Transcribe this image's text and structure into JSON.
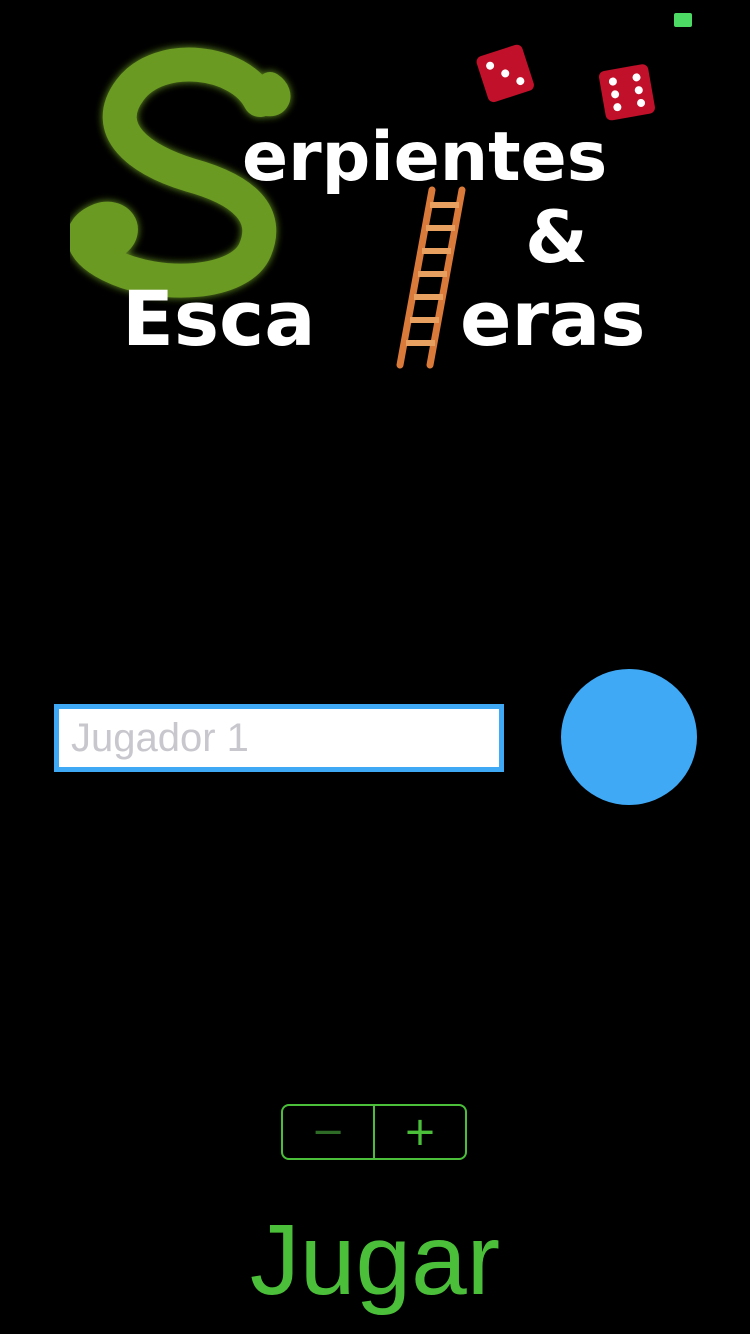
{
  "logo": {
    "line1": "erpientes",
    "ampersand": "&",
    "line2a": "Esca",
    "line2b": "eras"
  },
  "player": {
    "name_placeholder": "Jugador 1",
    "name_value": "",
    "color": "#3fa9f5"
  },
  "stepper": {
    "minus_label": "−",
    "plus_label": "+"
  },
  "play_label": "Jugar",
  "colors": {
    "background": "#000000",
    "accent_green": "#4bbf3a",
    "field_border": "#3fa9f5",
    "snake_green": "#6a9a24",
    "dice_red": "#c0102a",
    "status_dot": "#4cd964"
  }
}
